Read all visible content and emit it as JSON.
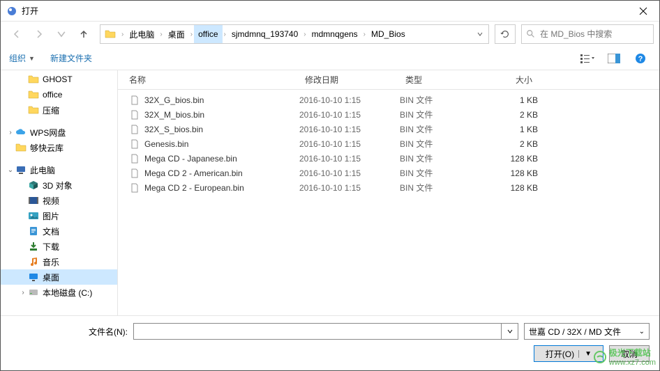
{
  "title": "打开",
  "breadcrumb": {
    "items": [
      "此电脑",
      "桌面",
      "office",
      "sjmdmnq_193740",
      "mdmnqgens",
      "MD_Bios"
    ],
    "active_index": 2
  },
  "search": {
    "placeholder": "在 MD_Bios 中搜索"
  },
  "toolbar": {
    "organize": "组织",
    "new_folder": "新建文件夹"
  },
  "columns": {
    "name": "名称",
    "date": "修改日期",
    "type": "类型",
    "size": "大小"
  },
  "sidebar": [
    {
      "label": "GHOST",
      "icon": "folder",
      "indent": 1
    },
    {
      "label": "office",
      "icon": "folder",
      "indent": 1
    },
    {
      "label": "压缩",
      "icon": "folder",
      "indent": 1
    },
    {
      "spacer": true
    },
    {
      "label": "WPS网盘",
      "icon": "cloud",
      "indent": 0,
      "expand": ">"
    },
    {
      "label": "够快云库",
      "icon": "folder-orange",
      "indent": 0,
      "expand": ""
    },
    {
      "spacer": true
    },
    {
      "label": "此电脑",
      "icon": "pc",
      "indent": 0,
      "expand": "v"
    },
    {
      "label": "3D 对象",
      "icon": "3d",
      "indent": 1
    },
    {
      "label": "视频",
      "icon": "video",
      "indent": 1
    },
    {
      "label": "图片",
      "icon": "pictures",
      "indent": 1
    },
    {
      "label": "文档",
      "icon": "documents",
      "indent": 1
    },
    {
      "label": "下载",
      "icon": "downloads",
      "indent": 1
    },
    {
      "label": "音乐",
      "icon": "music",
      "indent": 1
    },
    {
      "label": "桌面",
      "icon": "desktop",
      "indent": 1,
      "selected": true
    },
    {
      "label": "本地磁盘 (C:)",
      "icon": "disk",
      "indent": 1,
      "expand": ">"
    }
  ],
  "files": [
    {
      "name": "32X_G_bios.bin",
      "date": "2016-10-10 1:15",
      "type": "BIN 文件",
      "size": "1 KB"
    },
    {
      "name": "32X_M_bios.bin",
      "date": "2016-10-10 1:15",
      "type": "BIN 文件",
      "size": "2 KB"
    },
    {
      "name": "32X_S_bios.bin",
      "date": "2016-10-10 1:15",
      "type": "BIN 文件",
      "size": "1 KB"
    },
    {
      "name": "Genesis.bin",
      "date": "2016-10-10 1:15",
      "type": "BIN 文件",
      "size": "2 KB"
    },
    {
      "name": "Mega CD - Japanese.bin",
      "date": "2016-10-10 1:15",
      "type": "BIN 文件",
      "size": "128 KB"
    },
    {
      "name": "Mega CD 2 - American.bin",
      "date": "2016-10-10 1:15",
      "type": "BIN 文件",
      "size": "128 KB"
    },
    {
      "name": "Mega CD 2 - European.bin",
      "date": "2016-10-10 1:15",
      "type": "BIN 文件",
      "size": "128 KB"
    }
  ],
  "footer": {
    "filename_label": "文件名(N):",
    "filter": "世嘉 CD / 32X / MD 文件",
    "open": "打开(O)",
    "cancel": "取消"
  },
  "watermark": {
    "brand": "极光下载站",
    "url": "www.xz7.com"
  }
}
